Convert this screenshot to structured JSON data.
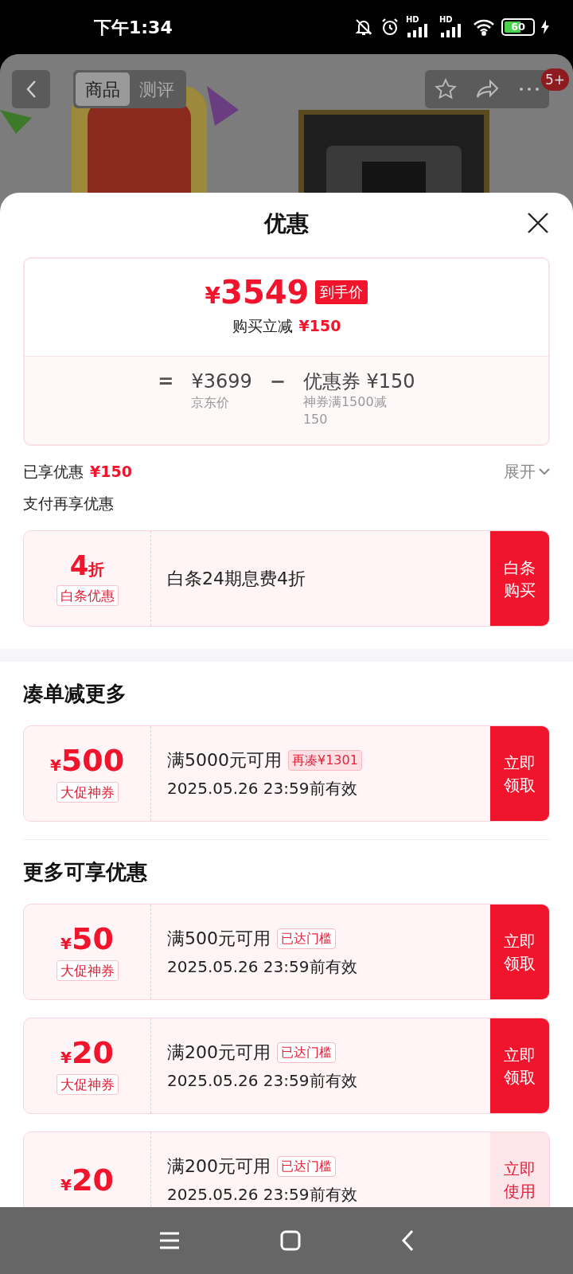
{
  "status_bar": {
    "time": "下午1:34",
    "signal_labels": [
      "HD",
      "HD"
    ],
    "battery": "60"
  },
  "header": {
    "tabs": [
      {
        "label": "商品",
        "selected": true
      },
      {
        "label": "测评",
        "selected": false
      }
    ],
    "badge": "5+"
  },
  "sheet": {
    "title": "优惠",
    "price_card": {
      "currency": "¥",
      "amount": "3549",
      "price_tag": "到手价",
      "discount_label": "购买立减",
      "discount": "¥150",
      "equals": "=",
      "base_price": "¥3699",
      "base_label": "京东价",
      "minus": "−",
      "coupon": "优惠券 ¥150",
      "coupon_note": "神券满1500减150"
    },
    "enjoyed": {
      "label": "已享优惠",
      "amount": "¥150",
      "expand": "展开"
    },
    "pay_section": {
      "title": "支付再享优惠",
      "offers": [
        {
          "value": "4",
          "unit": "折",
          "label": "白条优惠",
          "desc": "白条24期息费4折",
          "action": "白条购买"
        }
      ]
    },
    "bundle_section": {
      "title": "凑单减更多",
      "coupons": [
        {
          "currency": "¥",
          "amount": "500",
          "label": "大促神券",
          "condition": "满5000元可用",
          "badge": "再凑¥1301",
          "threshold_met": false,
          "validity": "2025.05.26 23:59前有效",
          "action": "立即领取",
          "claimed": false
        }
      ]
    },
    "more_section": {
      "title": "更多可享优惠",
      "coupons": [
        {
          "currency": "¥",
          "amount": "50",
          "label": "大促神券",
          "condition": "满500元可用",
          "badge": "已达门槛",
          "threshold_met": true,
          "validity": "2025.05.26 23:59前有效",
          "action": "立即领取",
          "claimed": false
        },
        {
          "currency": "¥",
          "amount": "20",
          "label": "大促神券",
          "condition": "满200元可用",
          "badge": "已达门槛",
          "threshold_met": true,
          "validity": "2025.05.26 23:59前有效",
          "action": "立即领取",
          "claimed": false
        },
        {
          "currency": "¥",
          "amount": "20",
          "condition": "满200元可用",
          "badge": "已达门槛",
          "threshold_met": true,
          "validity": "2025.05.26 23:59前有效",
          "action": "立即使用",
          "claimed": true
        }
      ]
    }
  }
}
